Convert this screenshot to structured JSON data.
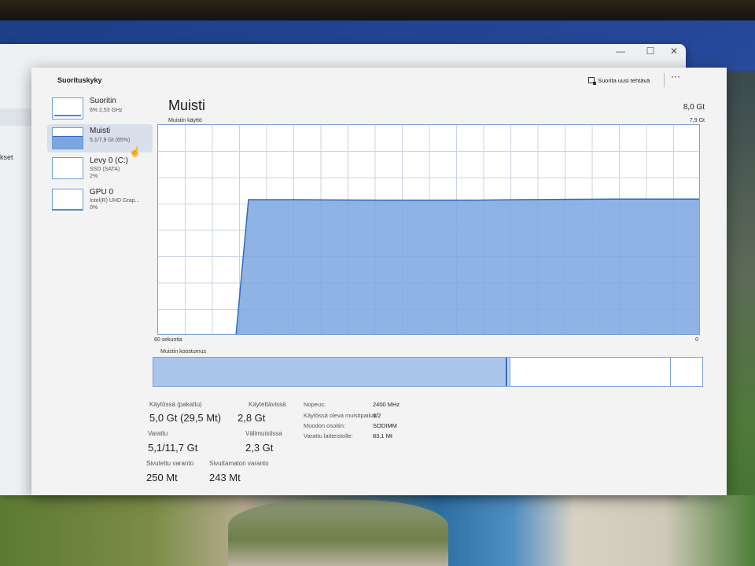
{
  "back_window": {
    "sidebar_fragment": "kset",
    "controls": [
      "—",
      "☐",
      "✕"
    ]
  },
  "window": {
    "title": "Suorituskyky",
    "new_task_label": "Suorita uusi tehtävä",
    "more_label": "···"
  },
  "sidebar": {
    "items": [
      {
        "name": "Suoritin",
        "sub1": "6% 2,53 GHz",
        "sub2": ""
      },
      {
        "name": "Muisti",
        "sub1": "5,1/7,9 Gt (65%)",
        "sub2": ""
      },
      {
        "name": "Levy 0 (C:)",
        "sub1": "SSD (SATA)",
        "sub2": "2%"
      },
      {
        "name": "GPU 0",
        "sub1": "Intel(R) UHD Grap...",
        "sub2": "0%"
      }
    ]
  },
  "main": {
    "title": "Muisti",
    "total": "8,0 Gt",
    "graph_label": "Muistin käyttö",
    "graph_max": "7,9 Gt",
    "axis_left": "60 sekuntia",
    "axis_right": "0",
    "composition_label": "Muistin koostumus"
  },
  "chart_data": {
    "type": "area",
    "title": "Muistin käyttö",
    "xlabel": "60 sekuntia",
    "ylabel": "",
    "xlim": [
      60,
      0
    ],
    "ylim": [
      0,
      7.9
    ],
    "units": "Gt",
    "x": [
      60,
      51,
      50,
      45,
      40,
      35,
      30,
      25,
      20,
      15,
      10,
      5,
      0
    ],
    "series": [
      {
        "values": [
          null,
          null,
          5.1,
          5.1,
          5.09,
          5.08,
          5.08,
          5.08,
          5.1,
          5.11,
          5.12,
          5.12,
          5.12
        ]
      }
    ]
  },
  "composition": {
    "in_use_fraction": 0.645,
    "modified_fraction": 0.006,
    "standby_fraction": 0.29
  },
  "stats": {
    "in_use_label": "Käytössä (pakattu)",
    "in_use_value": "5,0 Gt (29,5 Mt)",
    "available_label": "Käytettävissä",
    "available_value": "2,8 Gt",
    "committed_label": "Varattu",
    "committed_value": "5,1/11,7 Gt",
    "cached_label": "Välimuistissa",
    "cached_value": "2,3 Gt",
    "paged_label": "Sivutettu varanto",
    "paged_value": "250 Mt",
    "nonpaged_label": "Sivuttamaton varanto",
    "nonpaged_value": "243 Mt"
  },
  "properties": [
    {
      "label": "Nopeus:",
      "value": "2400 MHz"
    },
    {
      "label": "Käytössä oleva muistipaikat:",
      "value": "1/2"
    },
    {
      "label": "Muodon osoitin:",
      "value": "SODIMM"
    },
    {
      "label": "Varattu laitteistolle:",
      "value": "83,1 Mt"
    }
  ],
  "colors": {
    "accent": "#2f6ac1",
    "area_fill": "#7ba6e0",
    "grid": "#c9d4e2"
  }
}
